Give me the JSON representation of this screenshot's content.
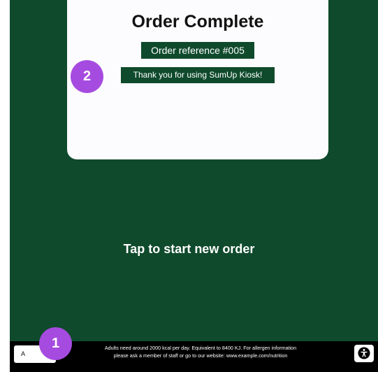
{
  "card": {
    "title": "Order Complete",
    "order_reference": "Order reference #005",
    "thank_you": "Thank you for using SumUp Kiosk!"
  },
  "main": {
    "tap_prompt": "Tap to start new order"
  },
  "footer": {
    "left_button_label": "A",
    "nutrition_line1": "Adults need around 2000 kcal per day. Equivalent to 8400 KJ. For allergen information",
    "nutrition_line2": "please ask a member of staff or go to our website: www.example.com/nutrition",
    "accessibility_icon": "accessibility-icon"
  },
  "markers": {
    "marker_1": "1",
    "marker_2": "2"
  },
  "colors": {
    "brand_green": "#0f4a2c",
    "marker_purple": "#a64be0"
  }
}
